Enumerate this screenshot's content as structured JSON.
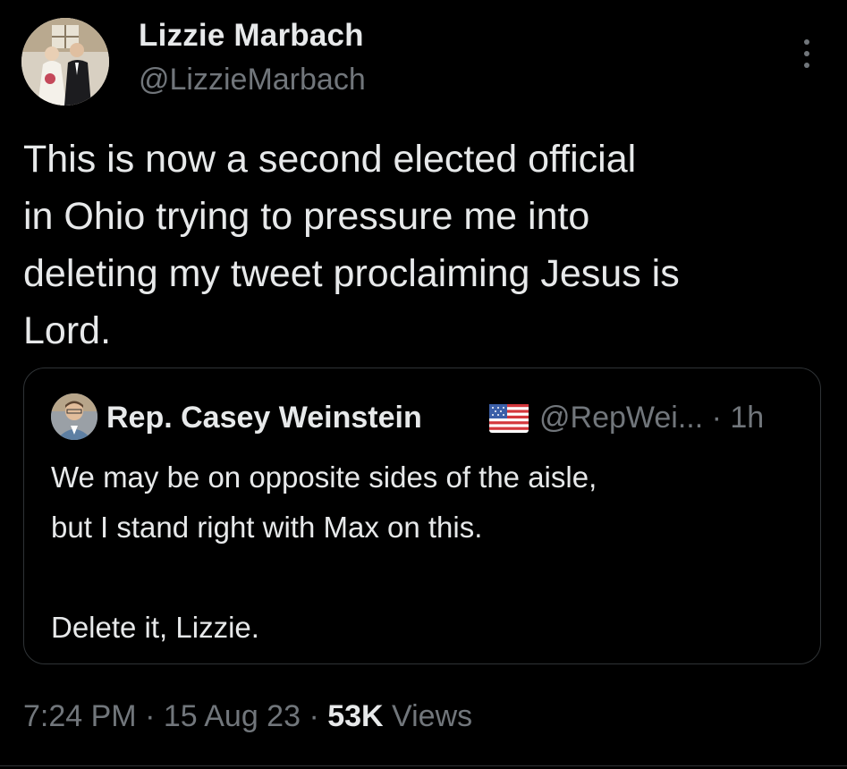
{
  "author": {
    "name": "Lizzie Marbach",
    "handle": "@LizzieMarbach"
  },
  "tweet": {
    "lines": [
      "This is now a second elected official",
      "in Ohio trying to pressure me into",
      "deleting my tweet proclaiming Jesus is",
      "Lord."
    ]
  },
  "quote": {
    "name": "Rep. Casey Weinstein",
    "handle": "@RepWei...",
    "time_separator": " · ",
    "time": "1h",
    "lines": [
      "We may be on opposite sides of the aisle,",
      "but I stand right with Max on this."
    ],
    "closing": "Delete it, Lizzie."
  },
  "meta": {
    "time": "7:24 PM",
    "date": "15 Aug 23",
    "views_count": "53K",
    "views_label": "Views",
    "separator": " · "
  },
  "colors": {
    "background": "#000000",
    "text": "#e7e9ea",
    "secondary": "#71767b",
    "border": "#2f3336"
  },
  "icons": {
    "more": "more-vertical-icon",
    "flag": "us-flag-icon"
  }
}
